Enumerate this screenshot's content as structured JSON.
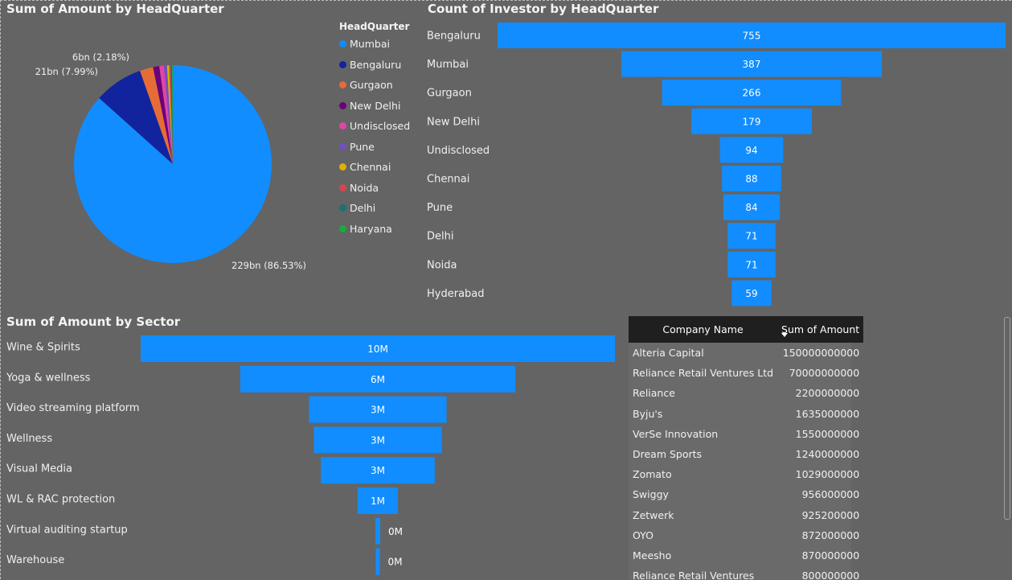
{
  "colors": {
    "bar": "#118dff",
    "background": "#646464",
    "text": "#f0f0f0",
    "header_bg": "#1f1f1f"
  },
  "chart_data": [
    {
      "type": "pie",
      "title": "Sum of Amount by HeadQuarter",
      "legend_title": "HeadQuarter",
      "legend_position": "right",
      "slices": [
        {
          "name": "Mumbai",
          "value": 229,
          "color": "#118dff",
          "label": "229bn (86.53%)"
        },
        {
          "name": "Bengaluru",
          "value": 21.1,
          "color": "#12239e",
          "label": "21bn (7.99%)"
        },
        {
          "name": "Gurgaon",
          "value": 5.77,
          "color": "#e66c37",
          "label": "6bn (2.18%)"
        },
        {
          "name": "New Delhi",
          "value": 2.7,
          "color": "#6b007b",
          "label": ""
        },
        {
          "name": "Undisclosed",
          "value": 2.0,
          "color": "#e044a7",
          "label": ""
        },
        {
          "name": "Pune",
          "value": 1.3,
          "color": "#744ec2",
          "label": ""
        },
        {
          "name": "Chennai",
          "value": 0.9,
          "color": "#d9b300",
          "label": ""
        },
        {
          "name": "Noida",
          "value": 0.7,
          "color": "#d64550",
          "label": ""
        },
        {
          "name": "Delhi",
          "value": 0.5,
          "color": "#197278",
          "label": ""
        },
        {
          "name": "Haryana",
          "value": 0.4,
          "color": "#1aab40",
          "label": ""
        }
      ]
    },
    {
      "type": "bar",
      "subtype": "funnel",
      "title": "Count of Investor by HeadQuarter",
      "categories": [
        "Bengaluru",
        "Mumbai",
        "Gurgaon",
        "New Delhi",
        "Undisclosed",
        "Chennai",
        "Pune",
        "Delhi",
        "Noida",
        "Hyderabad"
      ],
      "values": [
        755,
        387,
        266,
        179,
        94,
        88,
        84,
        71,
        71,
        59
      ],
      "labels": [
        "755",
        "387",
        "266",
        "179",
        "94",
        "88",
        "84",
        "71",
        "71",
        "59"
      ]
    },
    {
      "type": "bar",
      "subtype": "funnel",
      "title": "Sum of Amount by Sector",
      "categories": [
        "Wine & Spirits",
        "Yoga & wellness",
        "Video streaming platform",
        "Wellness",
        "Visual Media",
        "WL & RAC protection",
        "Virtual auditing startup",
        "Warehouse"
      ],
      "values": [
        10000000,
        5800000,
        2900000,
        2700000,
        2400000,
        850000,
        100000,
        50000
      ],
      "labels": [
        "10M",
        "6M",
        "3M",
        "3M",
        "3M",
        "1M",
        "0M",
        "0M"
      ]
    },
    {
      "type": "table",
      "columns": [
        "Company Name",
        "Sum of Amount"
      ],
      "rows": [
        [
          "Alteria Capital",
          "150000000000"
        ],
        [
          "Reliance Retail Ventures Ltd",
          "70000000000"
        ],
        [
          "Reliance",
          "2200000000"
        ],
        [
          "Byju's",
          "1635000000"
        ],
        [
          "VerSe Innovation",
          "1550000000"
        ],
        [
          "Dream Sports",
          "1240000000"
        ],
        [
          "Zomato",
          "1029000000"
        ],
        [
          "Swiggy",
          "956000000"
        ],
        [
          "Zetwerk",
          "925200000"
        ],
        [
          "OYO",
          "872000000"
        ],
        [
          "Meesho",
          "870000000"
        ],
        [
          "Reliance Retail Ventures",
          "800000000"
        ]
      ]
    }
  ]
}
